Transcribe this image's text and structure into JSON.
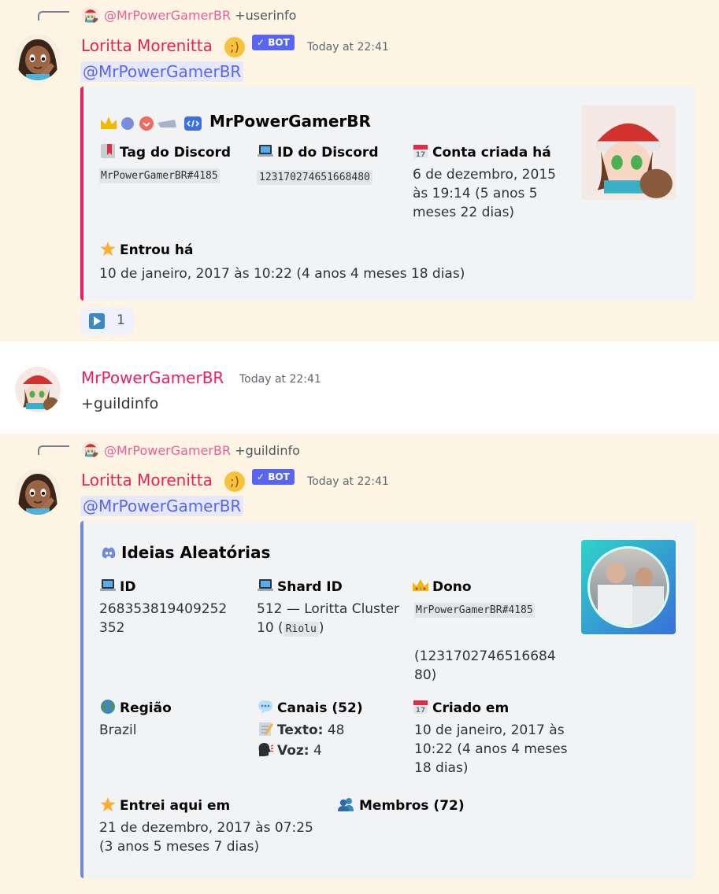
{
  "messages": [
    {
      "reply": {
        "mention": "@MrPowerGamerBR",
        "command": "+userinfo"
      },
      "author": "Loritta Morenitta",
      "bot_tag": "✓ BOT",
      "timestamp": "Today at 22:41",
      "mention": "@MrPowerGamerBR",
      "embed": {
        "accent": "#e91e63",
        "title": "MrPowerGamerBR",
        "fields": [
          {
            "name": "Tag do Discord",
            "icon": "bookmark-icon",
            "value": "MrPowerGamerBR#4185",
            "code": true
          },
          {
            "name": "ID do Discord",
            "icon": "laptop-icon",
            "value": "123170274651668480",
            "code": true
          },
          {
            "name": "Conta criada há",
            "icon": "calendar-icon",
            "value": "6 de dezembro, 2015 às 19:14 (5 anos 5 meses 22 dias)"
          },
          {
            "name": "Entrou há",
            "icon": "star-icon",
            "value": "10 de janeiro, 2017 às 10:22 (4 anos 4 meses 18 dias)"
          }
        ]
      },
      "reaction": {
        "icon": "play-icon",
        "count": "1"
      }
    },
    {
      "author": "MrPowerGamerBR",
      "timestamp": "Today at 22:41",
      "content": "+guildinfo"
    },
    {
      "reply": {
        "mention": "@MrPowerGamerBR",
        "command": "+guildinfo"
      },
      "author": "Loritta Morenitta",
      "bot_tag": "✓ BOT",
      "timestamp": "Today at 22:41",
      "mention": "@MrPowerGamerBR",
      "embed": {
        "accent": "#7289da",
        "title": "Ideias Aleatórias",
        "fields": [
          {
            "name": "ID",
            "icon": "laptop-icon",
            "value": "268353819409252352"
          },
          {
            "name": "Shard ID",
            "icon": "laptop-icon",
            "value_prefix": "512 — Loritta Cluster 10 (",
            "value_code": "Riolu",
            "value_suffix": ")"
          },
          {
            "name": "Dono",
            "icon": "crown-icon",
            "value": "MrPowerGamerBR#4185",
            "value_extra": "(123170274651668480)"
          },
          {
            "name": "Região",
            "icon": "globe-icon",
            "value": "Brazil"
          },
          {
            "name": "Canais (52)",
            "icon": "speech-bubble-icon",
            "text_label": "Texto:",
            "text_value": "48",
            "voice_label": "Voz:",
            "voice_value": "4"
          },
          {
            "name": "Criado em",
            "icon": "calendar-icon",
            "value": "10 de janeiro, 2017 às 10:22 (4 anos 4 meses 18 dias)"
          },
          {
            "name": "Entrei aqui em",
            "icon": "star-icon",
            "value": "21 de dezembro, 2017 às 07:25 (3 anos 5 meses 7 dias)"
          },
          {
            "name": "Membros (72)",
            "icon": "users-icon"
          }
        ]
      }
    }
  ],
  "colors": {
    "highlight": "#fdf4e3",
    "mention": "#5865f2",
    "bot_tag": "#5865f2"
  }
}
